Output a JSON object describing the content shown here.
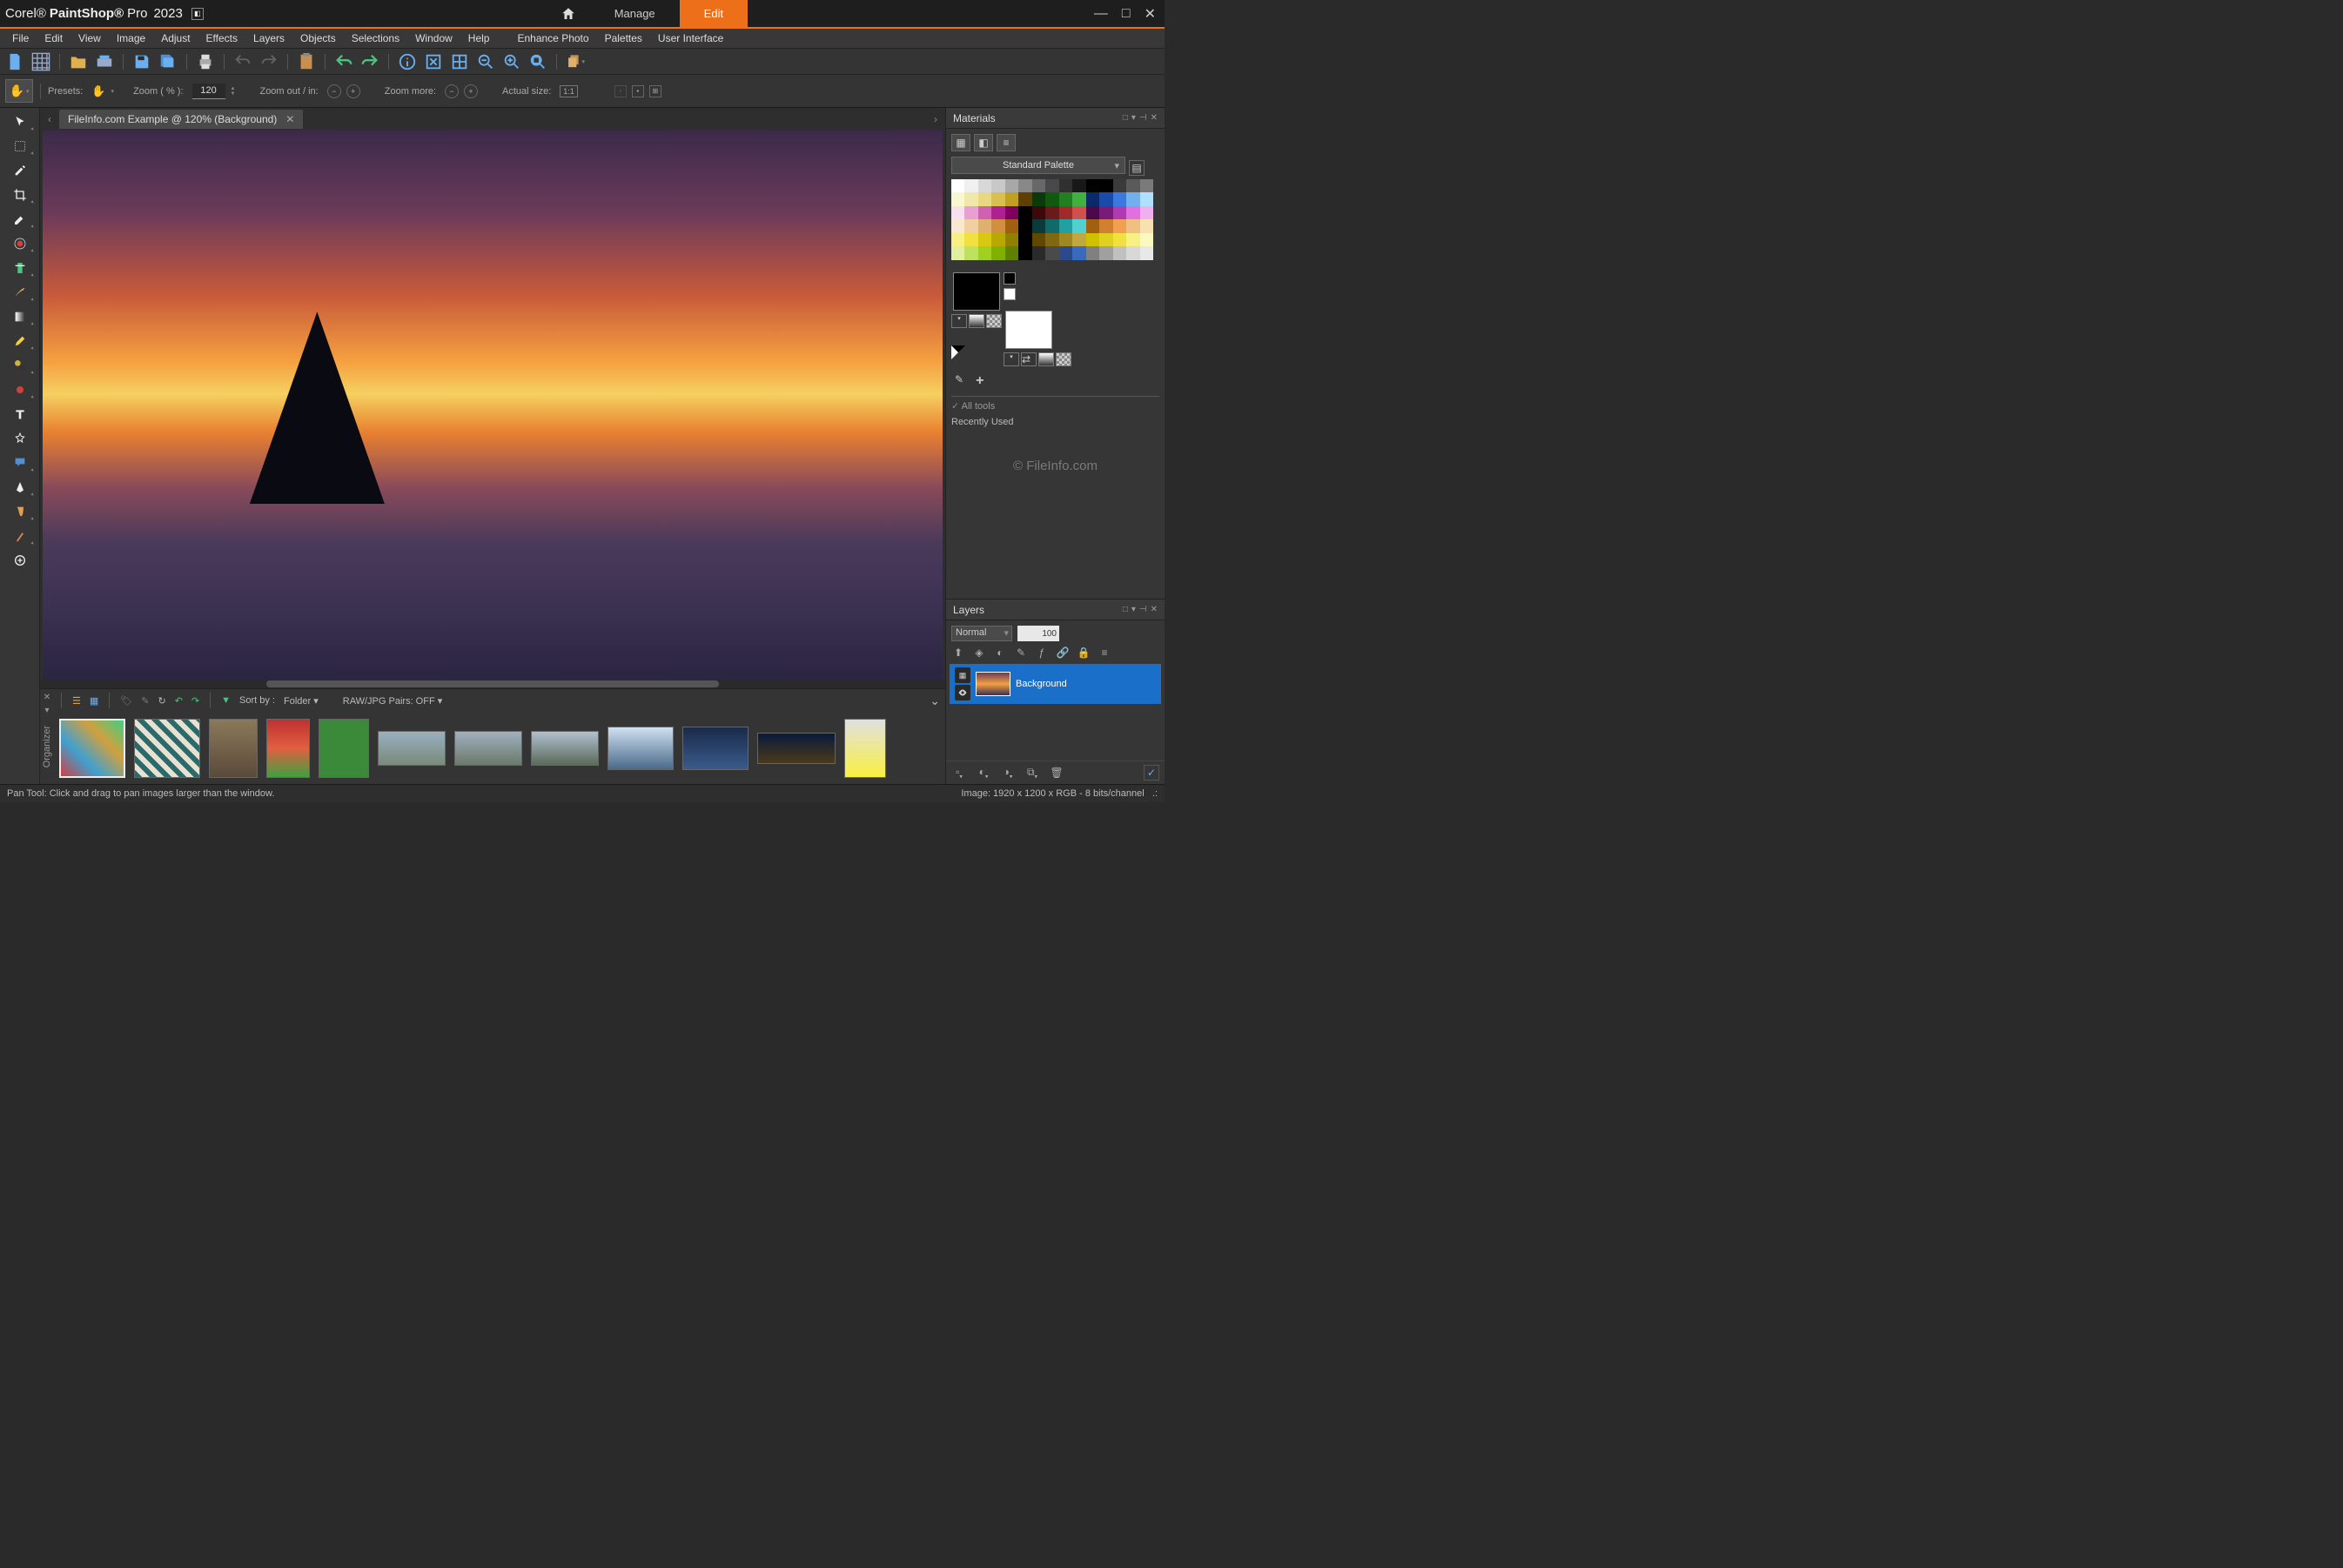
{
  "app": {
    "brand": "Corel®",
    "name": "PaintShop®",
    "suffix": "Pro",
    "year": "2023"
  },
  "workspace_tabs": {
    "manage": "Manage",
    "edit": "Edit",
    "active": "edit"
  },
  "menu": [
    "File",
    "Edit",
    "View",
    "Image",
    "Adjust",
    "Effects",
    "Layers",
    "Objects",
    "Selections",
    "Window",
    "Help",
    "Enhance Photo",
    "Palettes",
    "User Interface"
  ],
  "options": {
    "presets": "Presets:",
    "zoom_pct": "Zoom ( % ):",
    "zoom_value": "120",
    "zoom_out_in": "Zoom out / in:",
    "zoom_more": "Zoom more:",
    "actual_size": "Actual size:"
  },
  "document": {
    "tab": "FileInfo.com Example @ 120% (Background)"
  },
  "materials": {
    "title": "Materials",
    "palette": "Standard Palette",
    "all_tools": "All tools",
    "recent": "Recently Used",
    "watermark": "© FileInfo.com",
    "swatch_colors": [
      "#ffffff",
      "#f0f0f0",
      "#d8d8d8",
      "#c8c8c8",
      "#a8a8a8",
      "#888888",
      "#686868",
      "#484848",
      "#303030",
      "#181818",
      "#000000",
      "#000000",
      "#3a3a3a",
      "#5a5a5a",
      "#7a7a7a",
      "#f8f8d0",
      "#f0e8a8",
      "#e8d880",
      "#d8c050",
      "#c0a020",
      "#604000",
      "#0a3a0a",
      "#105a10",
      "#208020",
      "#40b040",
      "#0a2a6a",
      "#1a4aaa",
      "#3a7ae0",
      "#70b0f0",
      "#b0e0ff",
      "#f8e0f0",
      "#e8a0d0",
      "#d060b0",
      "#b02090",
      "#800060",
      "#000000",
      "#3a0a0a",
      "#6a1a1a",
      "#a02a2a",
      "#d05050",
      "#4a0a4a",
      "#7a1a7a",
      "#b03ab0",
      "#e070e0",
      "#f0b0f0",
      "#f8e8d0",
      "#f0d0a0",
      "#e0b070",
      "#d09040",
      "#a06010",
      "#000000",
      "#0a3a3a",
      "#106a6a",
      "#20a0a0",
      "#50d0d0",
      "#a06010",
      "#d08030",
      "#f0a050",
      "#f0c080",
      "#f8e0b0",
      "#f8f080",
      "#f0e040",
      "#d8c810",
      "#b8a800",
      "#908000",
      "#000000",
      "#604800",
      "#806810",
      "#a08820",
      "#c0a840",
      "#d0c000",
      "#e0d020",
      "#f0e040",
      "#f8f080",
      "#fafac0",
      "#e0f0a0",
      "#c0e060",
      "#a0d020",
      "#80b000",
      "#608000",
      "#000000",
      "#2a2a2a",
      "#4a4a4a",
      "#2a4a8a",
      "#3a6ac0",
      "#808080",
      "#a0a0a0",
      "#c0c0c0",
      "#d8d8d8",
      "#e8e8e8"
    ]
  },
  "layers": {
    "title": "Layers",
    "blend": "Normal",
    "opacity": "100",
    "layer_name": "Background"
  },
  "organizer": {
    "label": "Organizer",
    "sort_by": "Sort by :",
    "sort_value": "Folder",
    "raw_jpg": "RAW/JPG Pairs: OFF"
  },
  "status": {
    "left": "Pan Tool: Click and drag to pan images larger than the window.",
    "right": "Image:   1920 x 1200 x RGB - 8 bits/channel"
  }
}
